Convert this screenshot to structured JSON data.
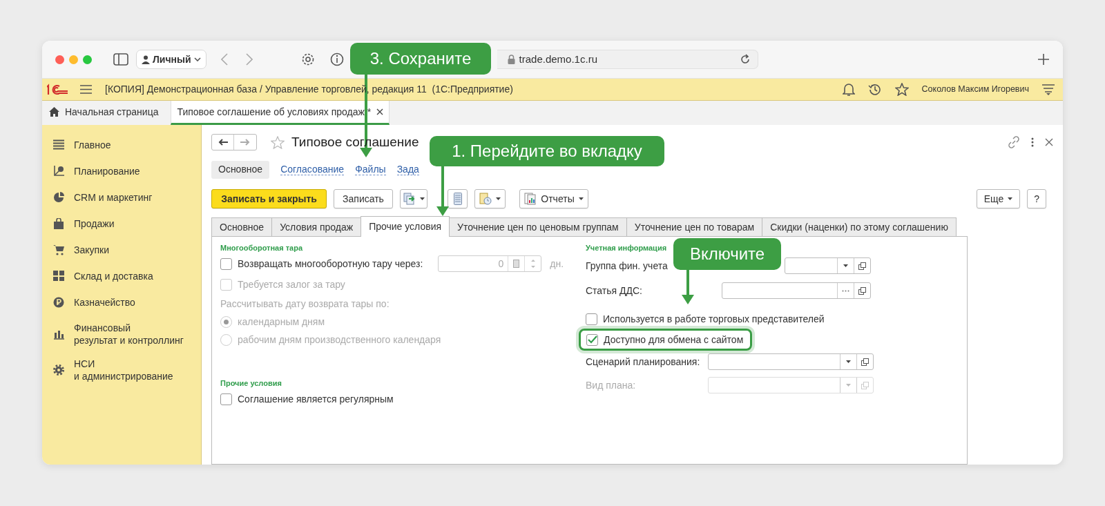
{
  "browser": {
    "profile": "Личный",
    "url": "trade.demo.1c.ru"
  },
  "app_bar": {
    "title": "[КОПИЯ] Демонстрационная база / Управление торговлей, редакция 11  (1С:Предприятие)",
    "user": "Соколов Максим Игоревич"
  },
  "tabs": [
    {
      "label": "Начальная страница",
      "selected": false,
      "kind": "home"
    },
    {
      "label": "Типовое соглашение об условиях продаж *",
      "selected": true,
      "kind": "document"
    }
  ],
  "sidebar": {
    "items": [
      {
        "label": "Главное"
      },
      {
        "label": "Планирование"
      },
      {
        "label": "CRM и маркетинг"
      },
      {
        "label": "Продажи"
      },
      {
        "label": "Закупки"
      },
      {
        "label": "Склад и доставка"
      },
      {
        "label": "Казначейство"
      },
      {
        "label": "Финансовый\nрезультат и контроллинг"
      },
      {
        "label": "НСИ\nи администрирование"
      }
    ]
  },
  "form": {
    "title": "Типовое соглашение",
    "starred": false,
    "nav_links": [
      {
        "label": "Основное",
        "selected": true
      },
      {
        "label": "Согласование",
        "selected": false
      },
      {
        "label": "Файлы",
        "selected": false
      },
      {
        "label": "Зада",
        "selected": false
      }
    ],
    "toolbar": [
      {
        "kind": "primary",
        "label": "Записать и закрыть"
      },
      {
        "kind": "text",
        "label": "Записать"
      },
      {
        "kind": "related",
        "menu": true
      },
      {
        "kind": "list",
        "menu": false
      },
      {
        "kind": "print",
        "menu": true
      },
      {
        "kind": "reports",
        "label": "Отчеты",
        "menu": true
      }
    ],
    "toolbar_right": [
      {
        "label": "Еще",
        "menu": true
      },
      {
        "label": "?",
        "menu": false
      }
    ],
    "tabs": [
      {
        "label": "Основное",
        "selected": false
      },
      {
        "label": "Условия продаж",
        "selected": false
      },
      {
        "label": "Прочие условия",
        "selected": true
      },
      {
        "label": "Уточнение цен по ценовым группам",
        "selected": false
      },
      {
        "label": "Уточнение цен по товарам",
        "selected": false
      },
      {
        "label": "Скидки (наценки) по этому соглашению",
        "selected": false
      }
    ],
    "left_sections": [
      {
        "title": "Многооборотная тара",
        "rows": [
          {
            "kind": "checkbox",
            "label": "Возвращать многооборотную тару через:",
            "checked": false,
            "disabled": false,
            "value": "0",
            "unit": "дн.",
            "field_disabled": true
          },
          {
            "kind": "checkbox",
            "label": "Требуется залог за тару",
            "checked": false,
            "disabled": true
          },
          {
            "kind": "text",
            "label": "Рассчитывать дату возврата тары по:",
            "disabled": true
          },
          {
            "kind": "radio",
            "label": "календарным дням",
            "selected": true,
            "disabled": true
          },
          {
            "kind": "radio",
            "label": "рабочим дням производственного календаря",
            "selected": false,
            "disabled": true
          }
        ]
      },
      {
        "title": "Прочие условия",
        "rows": [
          {
            "kind": "checkbox",
            "label": "Соглашение является регулярным",
            "checked": false,
            "disabled": false
          }
        ]
      }
    ],
    "right_section": {
      "title": "Учетная информация",
      "groups": [
        {
          "rows": [
            {
              "kind": "select",
              "label": "Группа фин. учета",
              "disabled": false
            },
            {
              "kind": "choice",
              "label": "Статья ДДС:",
              "disabled": false
            }
          ]
        },
        {
          "rows": [
            {
              "kind": "checkbox",
              "label": "Используется в работе торговых представителей",
              "checked": false,
              "disabled": false,
              "highlighted": false
            },
            {
              "kind": "checkbox",
              "label": "Доступно для обмена с сайтом",
              "checked": true,
              "disabled": false,
              "highlighted": true
            }
          ]
        },
        {
          "rows": [
            {
              "kind": "select",
              "label": "Сценарий планирования:",
              "disabled": false
            },
            {
              "kind": "select",
              "label": "Вид плана:",
              "disabled": true
            }
          ]
        }
      ]
    }
  },
  "callouts": [
    {
      "text": "3. Сохраните"
    },
    {
      "text": "1. Перейдите во вкладку"
    },
    {
      "text": "Включите"
    }
  ]
}
